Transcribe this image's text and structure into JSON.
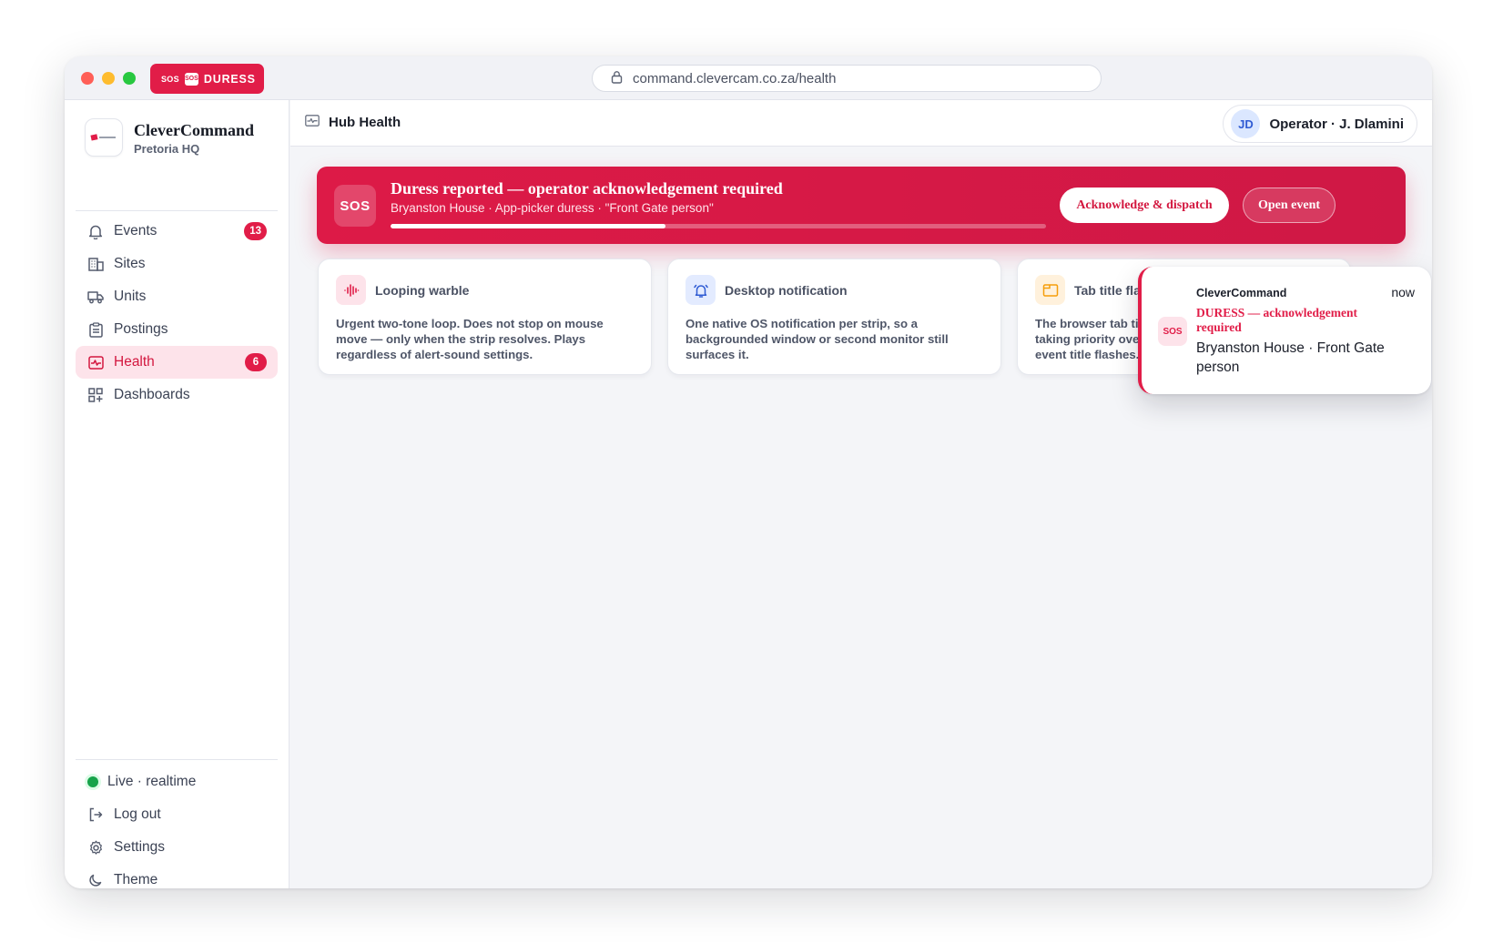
{
  "browser": {
    "url": "command.clevercam.co.za/health",
    "duress_pill": {
      "sos_mini": "SOS",
      "sos_box": "SOS",
      "label": "DURESS"
    }
  },
  "sidebar": {
    "brand_name": "CleverCommand",
    "brand_sub": "Pretoria HQ",
    "items": [
      {
        "label": "Events",
        "icon": "bell-icon",
        "badge": "13"
      },
      {
        "label": "Sites",
        "icon": "building-icon"
      },
      {
        "label": "Units",
        "icon": "truck-icon"
      },
      {
        "label": "Postings",
        "icon": "clipboard-icon"
      },
      {
        "label": "Health",
        "icon": "pulse-icon",
        "badge": "6",
        "active": true
      },
      {
        "label": "Dashboards",
        "icon": "grid-plus-icon"
      }
    ],
    "footer": {
      "live": "Live · realtime",
      "logout": "Log out",
      "settings": "Settings",
      "theme": "Theme"
    }
  },
  "header": {
    "title": "Hub Health",
    "operator": "Operator · J. Dlamini",
    "avatar_initials": "JD"
  },
  "alert": {
    "sos": "SOS",
    "title": "Duress reported — operator acknowledgement required",
    "subtitle": "Bryanston House · App-picker duress · \"Front Gate person\"",
    "progress": 0.42,
    "ack_label": "Acknowledge & dispatch",
    "open_label": "Open event"
  },
  "cards": [
    {
      "title": "Looping warble",
      "icon": "waveform-icon",
      "body": "Urgent two-tone loop. Does not stop on mouse move — only when the strip resolves. Plays regardless of alert-sound settings."
    },
    {
      "title": "Desktop notification",
      "icon": "alarm-bell-icon",
      "body": "One native OS notification per strip, so a backgrounded window or second monitor still surfaces it."
    },
    {
      "title": "Tab title flash",
      "icon": "window-icon",
      "body": "The browser tab title flashes until acknowledged, taking priority over the connection-lost and new-event title flashes."
    }
  ],
  "notification": {
    "app": "CleverCommand",
    "time": "now",
    "icon_text": "SOS",
    "title": "DURESS — acknowledgement required",
    "body": "Bryanston House · Front Gate person"
  },
  "colors": {
    "accent": "#e11d48",
    "active_bg": "#fde3ea",
    "live": "#16a34a"
  }
}
